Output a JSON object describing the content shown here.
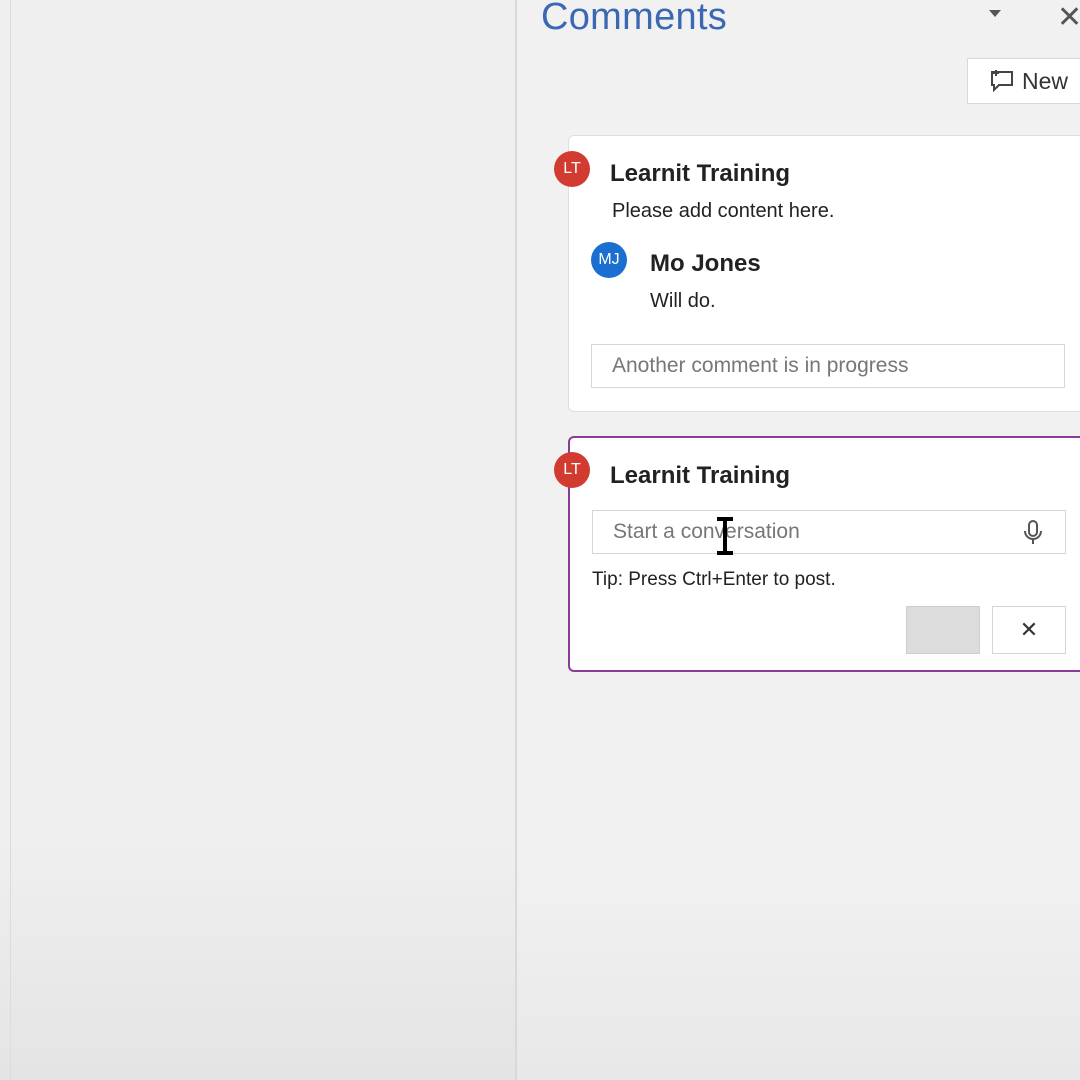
{
  "pane": {
    "title": "Comments",
    "close_glyph": "✕",
    "menu_icon": "chevron-down-icon",
    "new_button_label": "New",
    "new_button_icon": "new-comment-icon"
  },
  "threads": [
    {
      "comment": {
        "initials": "LT",
        "author": "Learnit Training",
        "text": "Please add content here.",
        "avatar_color": "#d23b2f"
      },
      "reply": {
        "initials": "MJ",
        "author": "Mo Jones",
        "text": "Will do.",
        "avatar_color": "#1a6fd0"
      },
      "reply_placeholder": "Another comment is in progress"
    }
  ],
  "draft": {
    "initials": "LT",
    "author": "Learnit Training",
    "placeholder": "Start a conversation",
    "tip": "Tip: Press Ctrl+Enter to post.",
    "cancel_glyph": "✕",
    "accent_color": "#8a3c9a"
  }
}
